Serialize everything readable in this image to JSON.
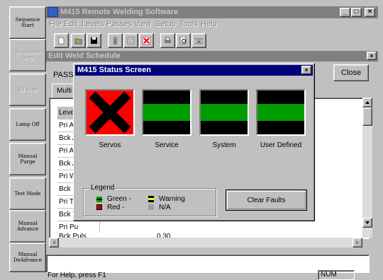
{
  "left_panel": {
    "buttons": [
      {
        "label": "Sequence Start",
        "enabled": true
      },
      {
        "label": "Sequence Stop",
        "enabled": false
      },
      {
        "label": "All Stop",
        "enabled": false
      },
      {
        "label": "Lamp Off",
        "enabled": true
      },
      {
        "label": "Manual Purge",
        "enabled": true
      },
      {
        "label": "Test Mode",
        "enabled": true
      },
      {
        "label": "Manual Advance",
        "enabled": true
      },
      {
        "label": "Manual DeAdvance",
        "enabled": true
      }
    ]
  },
  "app": {
    "title": "M415 Remote Welding Software",
    "menu": [
      "File",
      "Edit",
      "Levels",
      "Passes",
      "View",
      "Setup",
      "Tools",
      "Help"
    ],
    "window_controls": {
      "minimize": "_",
      "maximize": "□",
      "close": "×"
    }
  },
  "child_window": {
    "title": "Edit Weld Schedule",
    "pass_label": "PASS I",
    "close_label": "Close",
    "tab_label": "Multi",
    "rows": [
      "Level",
      "Pri An",
      "Bck A",
      "Pri AV",
      "Bck A",
      "Pri W",
      "Bck V",
      "Pri Tr",
      "Bck T",
      "Pri Pu",
      "Bck Puls"
    ],
    "bottom_cell": "0.30"
  },
  "status_bar": {
    "text": "For Help, press F1",
    "num": "NUM"
  },
  "dialog": {
    "title": "M415 Status Screen",
    "indicators": [
      {
        "label": "Servos",
        "state": "red"
      },
      {
        "label": "Service",
        "state": "green"
      },
      {
        "label": "System",
        "state": "green"
      },
      {
        "label": "User Defined",
        "state": "green"
      }
    ],
    "legend": {
      "title": "Legend",
      "green": "Green -",
      "red": "Red -",
      "warning": "Warning",
      "na": "N/A"
    },
    "clear_faults_label": "Clear Faults",
    "colors": {
      "red": "#ff0000",
      "green": "#009c00",
      "yellow": "#ffff00",
      "gray": "#a0a0a0",
      "title": "#00007c"
    }
  }
}
